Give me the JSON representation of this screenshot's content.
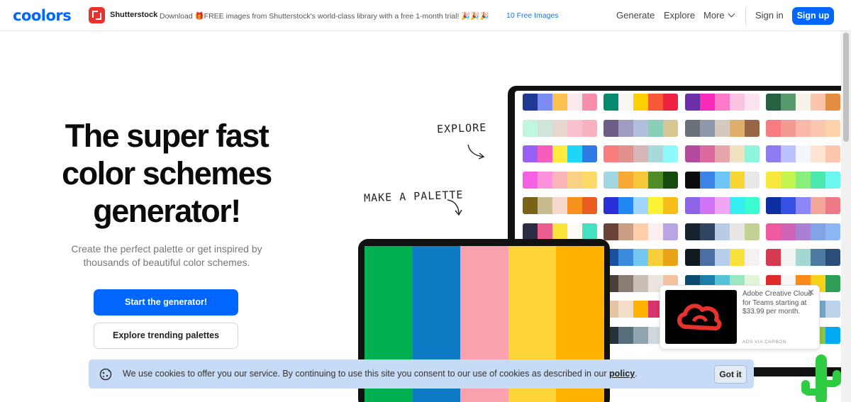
{
  "header": {
    "logo": "coolors",
    "ad_brand": "Shutterstock",
    "ad_text": "Download 🎁FREE images from Shutterstock's world-class library with a free 1-month trial! 🎉🎉🎉",
    "ad_link": "10 Free Images",
    "nav": {
      "generate": "Generate",
      "explore": "Explore",
      "more": "More",
      "signin": "Sign in",
      "signup": "Sign up"
    }
  },
  "hero": {
    "title_line1": "The super fast",
    "title_line2": "color schemes",
    "title_line3": "generator!",
    "subtitle_line1": "Create the perfect palette or get inspired by",
    "subtitle_line2": "thousands of beautiful color schemes.",
    "primary_button": "Start the generator!",
    "secondary_button": "Explore trending palettes"
  },
  "illustration": {
    "label_explore": "EXPLORE",
    "label_make": "MAKE A PALETTE",
    "tablet_colors": [
      "#00b050",
      "#0f7bc4",
      "#f9a2ae",
      "#fed536",
      "#ffb300"
    ],
    "palettes": [
      [
        "#1f3a93",
        "#7b8cf4",
        "#fdc350",
        "#fae9ea",
        "#f78fab"
      ],
      [
        "#028b6d",
        "#f9f7f1",
        "#fed001",
        "#f95738",
        "#ef2140"
      ],
      [
        "#6b2fa8",
        "#f72abb",
        "#ff7ac7",
        "#fcc4e2",
        "#fbe4ed"
      ],
      [
        "#276143",
        "#579a6d",
        "#f6f4ea",
        "#fcc4a8",
        "#e48d40"
      ],
      [
        "#c0f6db",
        "#cfe5d7",
        "#e6d7d0",
        "#f9c0cd",
        "#f8b1be"
      ],
      [
        "#6c5e86",
        "#a09bc0",
        "#afbfdc",
        "#8ad0b8",
        "#d8c795"
      ],
      [
        "#6b707b",
        "#8e9aac",
        "#d5c8bc",
        "#e2ae6c",
        "#986545"
      ],
      [
        "#f67c81",
        "#f59a93",
        "#f8b8aa",
        "#fac6ae",
        "#ffd4ab"
      ],
      [
        "#9a5ff4",
        "#f65cb9",
        "#ffeb3b",
        "#1fd6f8",
        "#2d7ae5"
      ],
      [
        "#fb7c7c",
        "#e2908e",
        "#d6b7b8",
        "#a9dadb",
        "#8ffafb"
      ],
      [
        "#b54b9e",
        "#dc6aa1",
        "#e5a6ac",
        "#efe1c2",
        "#8ef5db"
      ],
      [
        "#8e7bf0",
        "#bbc2fd",
        "#f4f6fe",
        "#fde5d1",
        "#fbc6ab"
      ],
      [
        "#f860e3",
        "#fc91dd",
        "#f9b5b8",
        "#fbd283",
        "#fcdb6b"
      ],
      [
        "#a0d7e0",
        "#f7a935",
        "#f7c83a",
        "#4e8d27",
        "#144a0e"
      ],
      [
        "#0c0c0c",
        "#3b83e6",
        "#6dc6f3",
        "#f9d435",
        "#e8e8e8"
      ],
      [
        "#f8e83e",
        "#c5f44f",
        "#88ef7a",
        "#4ce8ad",
        "#6cf6f0"
      ],
      [
        "#7a6317",
        "#c6bc8e",
        "#f6d8cc",
        "#f7921e",
        "#ea5f21"
      ],
      [
        "#2a2fd8",
        "#2388f4",
        "#a1d6ff",
        "#fdf236",
        "#f8bd18"
      ],
      [
        "#8e64e6",
        "#cf72f3",
        "#f0a6f2",
        "#36eef1",
        "#3dfbd0"
      ],
      [
        "#0d2e9f",
        "#3550e5",
        "#8c86f6",
        "#f2a599",
        "#ec7a86"
      ],
      [
        "#2c2d44",
        "#ec5d8f",
        "#fbe53a",
        "#fdfbf2",
        "#45e0c2"
      ],
      [
        "#6a4438",
        "#cb9e86",
        "#ffcfac",
        "#fbedf0",
        "#b7a5e6"
      ],
      [
        "#172430",
        "#304560",
        "#b9cce5",
        "#e9e5e4",
        "#c4d195"
      ],
      [
        "#ee5a9c",
        "#d063b6",
        "#a880d4",
        "#82a4e7",
        "#8db6f4"
      ],
      [
        "#2d6d84",
        "#3e9ea4",
        "#80c4d0",
        "#fbe06d",
        "#f44c56"
      ],
      [
        "#1b4f9f",
        "#3a8bde",
        "#74c5f0",
        "#f6cf3a",
        "#e8a316"
      ],
      [
        "#101820",
        "#4a6fa5",
        "#b6cdeb",
        "#f9e23b",
        "#f7f0f0"
      ],
      [
        "#d63a4e",
        "#f2f2f2",
        "#a3d8d2",
        "#4c7aa0",
        "#2a4d7a"
      ],
      [
        "#0b2b1c",
        "#127a45",
        "#d07db0",
        "#f4c6d8",
        "#fbe8ee"
      ],
      [
        "#4b3f3a",
        "#8a7c74",
        "#c9beb6",
        "#ece4de",
        "#f5c2a0"
      ],
      [
        "#0c4a6e",
        "#1b7fa8",
        "#58c2d8",
        "#9be7c2",
        "#e1f6d8"
      ],
      [
        "#e02b2b",
        "#f8f8f8",
        "#fb8a18",
        "#f8d21a",
        "#2e9e58"
      ],
      [
        "#f45b5b",
        "#f9a7a7",
        "#fef1f1",
        "#9ec8f9",
        "#4b7ff0"
      ],
      [
        "#e4c6a4",
        "#f3deca",
        "#ffb200",
        "#d9336b",
        "#8a1f4f"
      ],
      [
        "#f5f5f5",
        "#fad1a1",
        "#f3a45c",
        "#b35a2a",
        "#5a2e12"
      ],
      [
        "#1e3f66",
        "#2e5984",
        "#528aae",
        "#73a5c6",
        "#bcd2e8"
      ],
      [
        "#7e57c2",
        "#b39ddb",
        "#ede7f6",
        "#ffccbc",
        "#ff8a65"
      ],
      [
        "#263238",
        "#546e7a",
        "#90a4ae",
        "#cfd8dc",
        "#eceff1"
      ],
      [
        "#00695c",
        "#26a69a",
        "#80cbc4",
        "#e0f2f1",
        "#fff3e0"
      ],
      [
        "#f44336",
        "#ff9800",
        "#ffeb3b",
        "#8bc34a",
        "#03a9f4"
      ]
    ]
  },
  "ad": {
    "text": "Adobe Creative Cloud for Teams starting at $33.99 per month.",
    "via": "ADS VIA CARBON",
    "close": "✕"
  },
  "cookie": {
    "text": "We use cookies to offer you our service. By continuing to use this site you consent to our use of cookies as described in our",
    "link": "policy",
    "after": ".",
    "button": "Got it"
  },
  "colors": {
    "accent": "#0066ff",
    "cookie_bg": "#c6dbf6",
    "ad_red": "#e8322d"
  }
}
